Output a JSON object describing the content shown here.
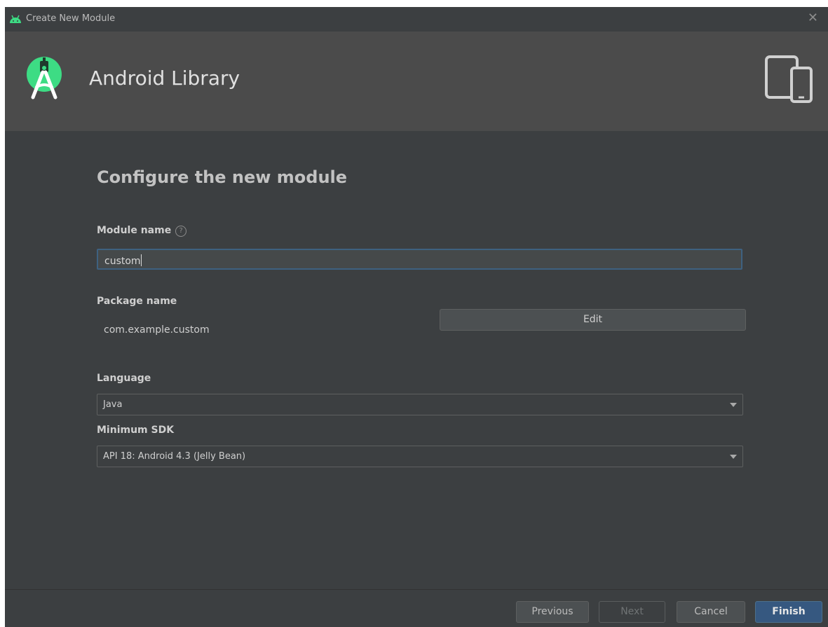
{
  "window": {
    "title": "Create New Module"
  },
  "header": {
    "title": "Android Library"
  },
  "form": {
    "heading": "Configure the new module",
    "module_name": {
      "label": "Module name",
      "value": "custom"
    },
    "package_name": {
      "label": "Package name",
      "value": "com.example.custom",
      "edit_label": "Edit"
    },
    "language": {
      "label": "Language",
      "selected": "Java"
    },
    "minimum_sdk": {
      "label": "Minimum SDK",
      "selected": "API 18: Android 4.3 (Jelly Bean)"
    }
  },
  "footer": {
    "previous_label": "Previous",
    "next_label": "Next",
    "cancel_label": "Cancel",
    "finish_label": "Finish"
  },
  "colors": {
    "background": "#3c3f41",
    "header_background": "#4b4b4b",
    "primary_button": "#365880",
    "android_green": "#3ddc84",
    "focus_border": "#3e6180"
  },
  "icons": {
    "title": "android-icon",
    "header_logo": "android-studio-logo",
    "header_right": "devices-icon",
    "help": "help-icon",
    "close": "close-icon",
    "dropdown": "chevron-down-icon"
  }
}
